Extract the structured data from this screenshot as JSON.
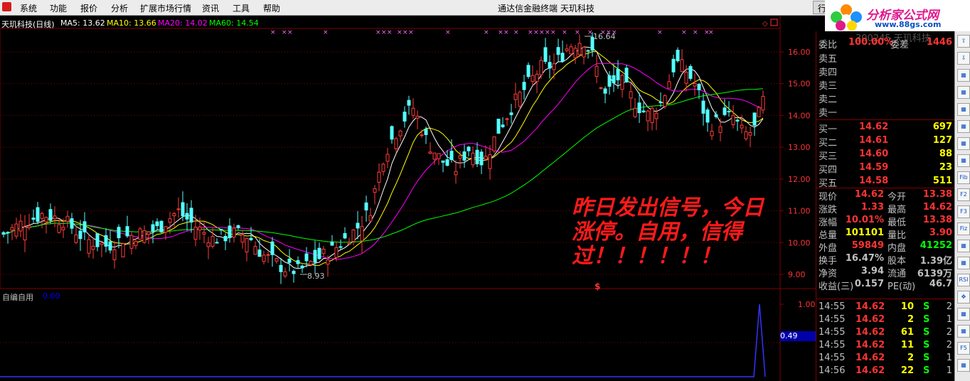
{
  "menu": {
    "items": [
      "系统",
      "功能",
      "报价",
      "分析",
      "扩展市场行情",
      "资讯",
      "工具",
      "帮助"
    ]
  },
  "window_title": "通达信金融终端   天玑科技",
  "title_button": "行",
  "logo": {
    "text": "分析家公式网",
    "url": "www.88gs.com"
  },
  "chart_header": {
    "stock": "天玑科技(日线)",
    "ma5": "MA5: 13.62",
    "ma10": "MA10: 13.66",
    "ma20": "MA20: 14.02",
    "ma60": "MA60: 14.54",
    "colors": {
      "ma5": "#ffffff",
      "ma10": "#ffff00",
      "ma20": "#ff00ff",
      "ma60": "#00ff00"
    }
  },
  "price_axis": {
    "labels": [
      "16.00",
      "15.00",
      "14.00",
      "13.00",
      "12.00",
      "11.00",
      "10.00",
      "9.00"
    ]
  },
  "high_marker": "16.64",
  "low_marker": "8.93",
  "signal_symbol": "$",
  "annotation": "昨日发出信号，今日涨停。自用，信得过！！！！！！",
  "sub_chart": {
    "title": "自编自用",
    "value": "0.00",
    "axis_labels": [
      "1.00",
      "0.49"
    ],
    "current_marker": "0.49"
  },
  "right_panel": {
    "stock_header": "300245 天玑科技",
    "weibi": {
      "label": "委比",
      "value": "100.00%",
      "label2": "委差",
      "value2": "1446"
    },
    "asks": [
      {
        "label": "卖五"
      },
      {
        "label": "卖四"
      },
      {
        "label": "卖三"
      },
      {
        "label": "卖二"
      },
      {
        "label": "卖一"
      }
    ],
    "bids": [
      {
        "label": "买一",
        "price": "14.62",
        "vol": "697"
      },
      {
        "label": "买二",
        "price": "14.61",
        "vol": "127"
      },
      {
        "label": "买三",
        "price": "14.60",
        "vol": "88"
      },
      {
        "label": "买四",
        "price": "14.59",
        "vol": "23"
      },
      {
        "label": "买五",
        "price": "14.58",
        "vol": "511"
      }
    ],
    "quote": [
      {
        "l1": "现价",
        "v1": "14.62",
        "l2": "今开",
        "v2": "13.38"
      },
      {
        "l1": "涨跌",
        "v1": "1.33",
        "l2": "最高",
        "v2": "14.62"
      },
      {
        "l1": "涨幅",
        "v1": "10.01%",
        "l2": "最低",
        "v2": "13.38"
      },
      {
        "l1": "总量",
        "v1": "101101",
        "l2": "量比",
        "v2": "3.90"
      },
      {
        "l1": "外盘",
        "v1": "59849",
        "l2": "内盘",
        "v2": "41252"
      },
      {
        "l1": "换手",
        "v1": "16.47%",
        "l2": "股本",
        "v2": "1.39亿"
      },
      {
        "l1": "净资",
        "v1": "3.94",
        "l2": "流通",
        "v2": "6139万"
      },
      {
        "l1": "收益(三)",
        "v1": "0.157",
        "l2": "PE(动)",
        "v2": "46.7"
      }
    ],
    "ticks": [
      {
        "time": "14:55",
        "price": "14.62",
        "vol": "10",
        "bs": "S",
        "n": "2"
      },
      {
        "time": "14:55",
        "price": "14.62",
        "vol": "2",
        "bs": "S",
        "n": "1"
      },
      {
        "time": "14:55",
        "price": "14.62",
        "vol": "61",
        "bs": "S",
        "n": "2"
      },
      {
        "time": "14:55",
        "price": "14.62",
        "vol": "11",
        "bs": "S",
        "n": "2"
      },
      {
        "time": "14:55",
        "price": "14.62",
        "vol": "2",
        "bs": "S",
        "n": "1"
      },
      {
        "time": "14:56",
        "price": "14.62",
        "vol": "22",
        "bs": "S",
        "n": "1"
      }
    ]
  },
  "toolbar": {
    "icons": [
      "up-arrow-icon",
      "down-arrow-icon",
      "bar-chart-icon",
      "window-icon",
      "line-chart-icon",
      "trend-icon",
      "candles-icon",
      "dots-icon",
      "fib-icon",
      "f2-icon",
      "f3-icon",
      "fiz-icon",
      "curve-icon",
      "window2-icon",
      "rsi-icon",
      "cross-icon",
      "bars2-icon",
      "window3-icon",
      "f5-icon",
      "chart-icon"
    ]
  }
}
